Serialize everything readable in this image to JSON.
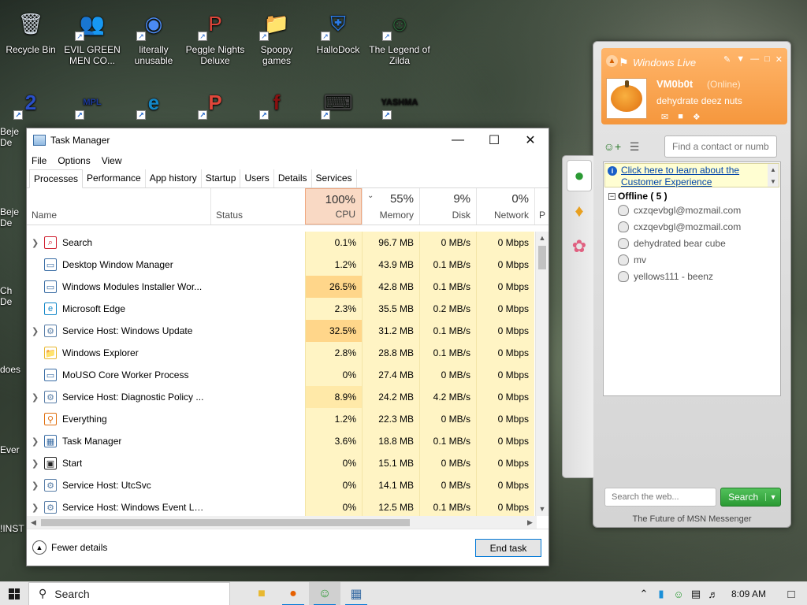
{
  "desktop": {
    "icons": [
      {
        "label": "Recycle Bin",
        "glyph": "🗑",
        "color": "#cfd8e0"
      },
      {
        "label": "EVIL GREEN MEN CO...",
        "glyph": "👥",
        "color": "#3fae3f"
      },
      {
        "label": "literally unusable",
        "glyph": "◉",
        "color": "#4a8af4"
      },
      {
        "label": "Peggle Nights Deluxe",
        "glyph": "P",
        "color": "#e0463a"
      },
      {
        "label": "Spoopy games",
        "glyph": "📁",
        "color": "#d8a848"
      },
      {
        "label": "HalloDock",
        "glyph": "⛨",
        "color": "#2c7be5"
      },
      {
        "label": "The Legend of Zilda",
        "glyph": "☺",
        "color": "#2b6b3b"
      }
    ],
    "row2": [
      {
        "glyph": "2",
        "color": "#2a4fc8"
      },
      {
        "glyph": "MPL",
        "color": "#1c3a9a"
      },
      {
        "glyph": "e",
        "color": "#1387c8"
      },
      {
        "glyph": "P",
        "color": "#e0463a"
      },
      {
        "glyph": "f",
        "color": "#8a1010"
      },
      {
        "glyph": "⌨",
        "color": "#444444"
      },
      {
        "glyph": "YASHMA",
        "color": "#111111"
      }
    ],
    "partial_labels": [
      "Beje",
      "De",
      "Beje",
      "De",
      "Ch",
      "De",
      "does",
      "Ever",
      "!INST"
    ]
  },
  "task_manager": {
    "title": "Task Manager",
    "menu": [
      "File",
      "Options",
      "View"
    ],
    "tabs": [
      "Processes",
      "Performance",
      "App history",
      "Startup",
      "Users",
      "Details",
      "Services"
    ],
    "columns": {
      "name": "Name",
      "status": "Status",
      "cpu": {
        "pct": "100%",
        "label": "CPU"
      },
      "memory": {
        "pct": "55%",
        "label": "Memory"
      },
      "disk": {
        "pct": "9%",
        "label": "Disk"
      },
      "network": {
        "pct": "0%",
        "label": "Network"
      },
      "power": "P"
    },
    "processes": [
      {
        "name": "Search",
        "expand": true,
        "icon": "⌕",
        "icolor": "#d02030",
        "cpu": "0.1%",
        "mem": "96.7 MB",
        "disk": "0 MB/s",
        "net": "0 Mbps",
        "heat": ""
      },
      {
        "name": "Desktop Window Manager",
        "expand": false,
        "icon": "▭",
        "icolor": "#3b6ea5",
        "cpu": "1.2%",
        "mem": "43.9 MB",
        "disk": "0.1 MB/s",
        "net": "0 Mbps",
        "heat": ""
      },
      {
        "name": "Windows Modules Installer Wor...",
        "expand": false,
        "icon": "▭",
        "icolor": "#3b6ea5",
        "cpu": "26.5%",
        "mem": "42.8 MB",
        "disk": "0.1 MB/s",
        "net": "0 Mbps",
        "heat": "hot"
      },
      {
        "name": "Microsoft Edge",
        "expand": false,
        "icon": "e",
        "icolor": "#1387c8",
        "cpu": "2.3%",
        "mem": "35.5 MB",
        "disk": "0.2 MB/s",
        "net": "0 Mbps",
        "heat": ""
      },
      {
        "name": "Service Host: Windows Update",
        "expand": true,
        "icon": "⚙",
        "icolor": "#5a7fa8",
        "cpu": "32.5%",
        "mem": "31.2 MB",
        "disk": "0.1 MB/s",
        "net": "0 Mbps",
        "heat": "hot"
      },
      {
        "name": "Windows Explorer",
        "expand": false,
        "icon": "📁",
        "icolor": "#e8b830",
        "cpu": "2.8%",
        "mem": "28.8 MB",
        "disk": "0.1 MB/s",
        "net": "0 Mbps",
        "heat": ""
      },
      {
        "name": "MoUSO Core Worker Process",
        "expand": false,
        "icon": "▭",
        "icolor": "#3b6ea5",
        "cpu": "0%",
        "mem": "27.4 MB",
        "disk": "0 MB/s",
        "net": "0 Mbps",
        "heat": ""
      },
      {
        "name": "Service Host: Diagnostic Policy ...",
        "expand": true,
        "icon": "⚙",
        "icolor": "#5a7fa8",
        "cpu": "8.9%",
        "mem": "24.2 MB",
        "disk": "4.2 MB/s",
        "net": "0 Mbps",
        "heat": "warm"
      },
      {
        "name": "Everything",
        "expand": false,
        "icon": "⚲",
        "icolor": "#e07010",
        "cpu": "1.2%",
        "mem": "22.3 MB",
        "disk": "0 MB/s",
        "net": "0 Mbps",
        "heat": ""
      },
      {
        "name": "Task Manager",
        "expand": true,
        "icon": "▦",
        "icolor": "#3b6ea5",
        "cpu": "3.6%",
        "mem": "18.8 MB",
        "disk": "0.1 MB/s",
        "net": "0 Mbps",
        "heat": ""
      },
      {
        "name": "Start",
        "expand": true,
        "icon": "▣",
        "icolor": "#222222",
        "cpu": "0%",
        "mem": "15.1 MB",
        "disk": "0 MB/s",
        "net": "0 Mbps",
        "heat": ""
      },
      {
        "name": "Service Host: UtcSvc",
        "expand": true,
        "icon": "⚙",
        "icolor": "#5a7fa8",
        "cpu": "0%",
        "mem": "14.1 MB",
        "disk": "0 MB/s",
        "net": "0 Mbps",
        "heat": ""
      },
      {
        "name": "Service Host: Windows Event Log",
        "expand": true,
        "icon": "⚙",
        "icolor": "#5a7fa8",
        "cpu": "0%",
        "mem": "12.5 MB",
        "disk": "0.1 MB/s",
        "net": "0 Mbps",
        "heat": ""
      }
    ],
    "fewer_details": "Fewer details",
    "end_task": "End task"
  },
  "messenger": {
    "brand": "Windows Live",
    "username": "VM0b0t",
    "status": "(Online)",
    "personal_message": "dehydrate deez nuts",
    "find_placeholder": "Find a contact or number",
    "banner": "Click here to learn about the Customer Experience",
    "group": "Offline ( 5 )",
    "contacts": [
      "cxzqevbgl@mozmail.com",
      "cxzqevbgl@mozmail.com",
      "dehydrated bear cube",
      "mv",
      "yellows111 - beenz"
    ],
    "web_placeholder": "Search the web...",
    "search_button": "Search",
    "footer": "The Future of MSN Messenger"
  },
  "taskbar": {
    "search": "Search",
    "clock": "8:09 AM"
  }
}
